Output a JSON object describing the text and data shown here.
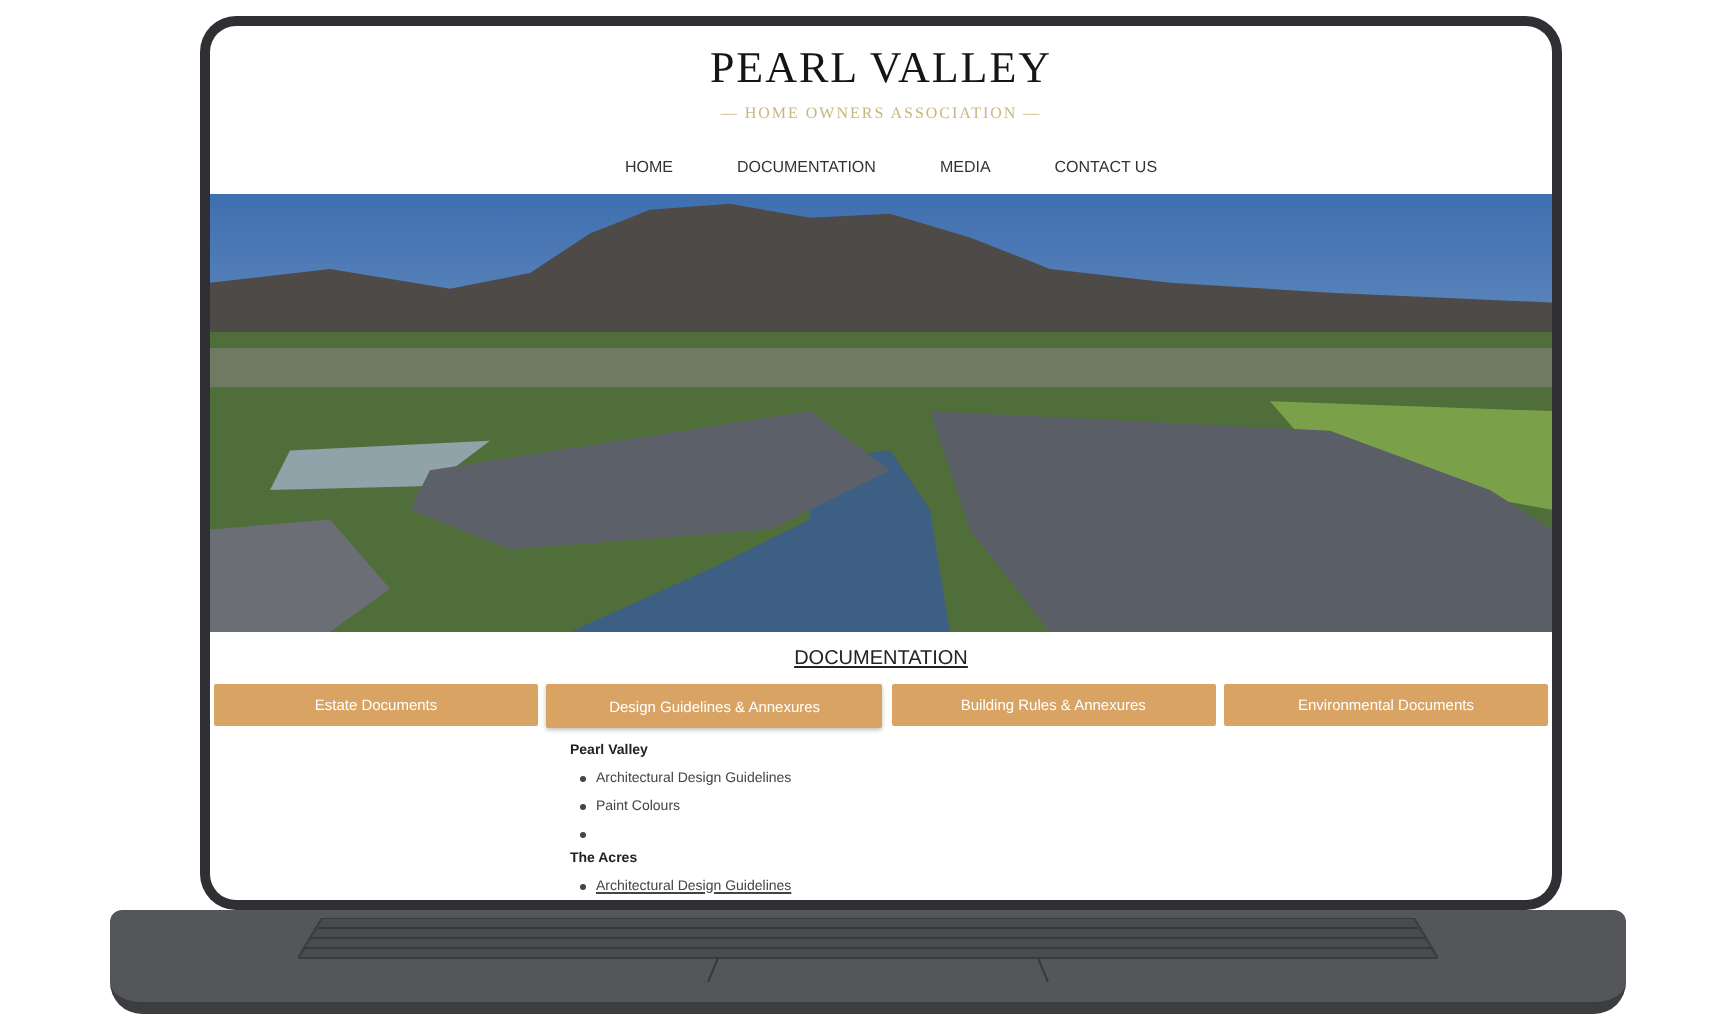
{
  "site": {
    "logo_title": "PEARL VALLEY",
    "logo_subtitle": "— HOME OWNERS ASSOCIATION —"
  },
  "nav": [
    {
      "label": "HOME"
    },
    {
      "label": "DOCUMENTATION"
    },
    {
      "label": "MEDIA"
    },
    {
      "label": "CONTACT US"
    }
  ],
  "section_heading": "DOCUMENTATION",
  "category_buttons": [
    {
      "label": "Estate Documents",
      "selected": false
    },
    {
      "label": "Design Guidelines & Annexures",
      "selected": true
    },
    {
      "label": "Building Rules & Annexures",
      "selected": false
    },
    {
      "label": "Environmental Documents",
      "selected": false
    }
  ],
  "document_groups": [
    {
      "title": "Pearl Valley",
      "items": [
        {
          "kind": "link",
          "text": "Architectural Design Guidelines",
          "underlined": false
        },
        {
          "kind": "link",
          "text": "Paint Colours",
          "underlined": false
        },
        {
          "kind": "blank"
        }
      ]
    },
    {
      "title": "The Acres",
      "items": [
        {
          "kind": "link",
          "text": "Architectural Design Guidelines",
          "underlined": true
        }
      ]
    }
  ]
}
